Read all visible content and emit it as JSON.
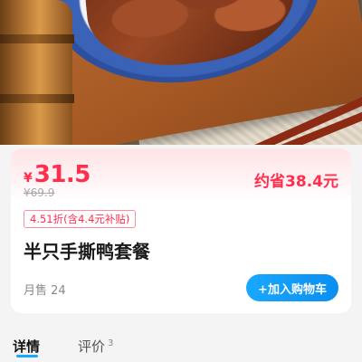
{
  "product": {
    "currency": "¥",
    "price": "31.5",
    "original_price": "¥69.9",
    "savings": "约省38.4元",
    "discount_tag": "4.51折(含4.4元补贴)",
    "title": "半只手撕鸭套餐",
    "monthly_sales": "月售 24",
    "add_to_cart_label": "+加入购物车"
  },
  "tabs": [
    {
      "label": "详情",
      "active": true
    },
    {
      "label": "评价",
      "count": "3",
      "active": false
    }
  ],
  "colors": {
    "price_red": "#ff2e4d",
    "accent_blue": "#19a8ff",
    "page_bg": "#f4f4f4"
  },
  "images": {
    "hero": "braised-duck-on-blue-plate-photo"
  }
}
